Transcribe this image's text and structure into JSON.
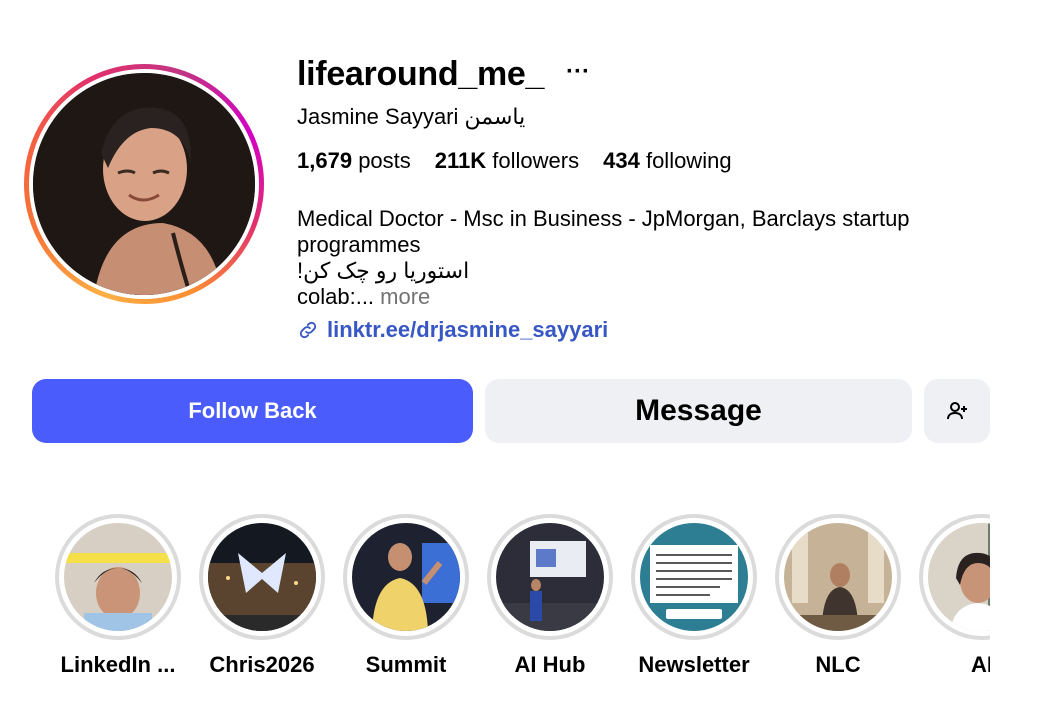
{
  "profile": {
    "username": "lifearound_me_",
    "more_icon": "ellipsis-icon",
    "full_name": "Jasmine Sayyari یاسمن",
    "stats": {
      "posts_count": "1,679",
      "posts_label": "posts",
      "followers_count": "211K",
      "followers_label": "followers",
      "following_count": "434",
      "following_label": "following"
    },
    "bio": {
      "line1": "Medical Doctor - Msc in Business - JpMorgan, Barclays startup",
      "line2": "programmes",
      "line3": "استوریا رو چک کن!",
      "line4": "colab:...",
      "more": "more"
    },
    "link": {
      "icon": "link-icon",
      "text": "linktr.ee/drjasmine_sayyari",
      "color": "#3757c4"
    }
  },
  "actions": {
    "follow_back": "Follow Back",
    "message": "Message",
    "add_user_icon": "add-user-icon",
    "follow_color": "#4a5dfc"
  },
  "highlights": [
    {
      "label": "LinkedIn ..."
    },
    {
      "label": "Chris2026"
    },
    {
      "label": "Summit"
    },
    {
      "label": "AI Hub"
    },
    {
      "label": "Newsletter"
    },
    {
      "label": "NLC"
    },
    {
      "label": "AI"
    }
  ]
}
